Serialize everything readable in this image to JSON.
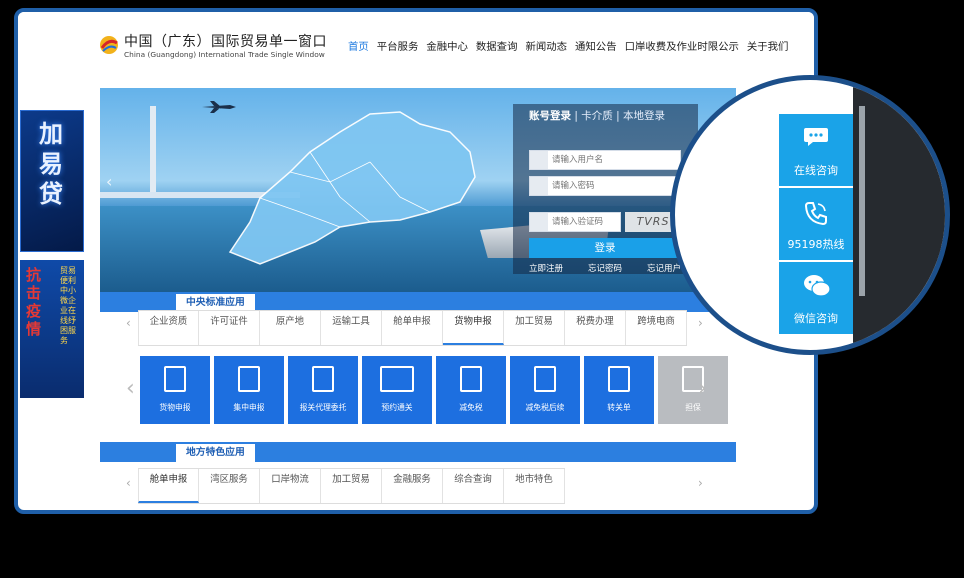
{
  "header": {
    "logo_title": "中国（广东）国际贸易单一窗口",
    "logo_subtitle": "China (Guangdong) International Trade Single Window",
    "nav": [
      "首页",
      "平台服务",
      "金融中心",
      "数据查询",
      "新闻动态",
      "通知公告",
      "口岸收费及作业时限公示",
      "关于我们"
    ],
    "active_nav": "首页"
  },
  "ads": {
    "ad1_text": "加易贷",
    "ad2_title": "抗击疫情",
    "ad2_text": "贸易便利中小微企业在线纾困服务"
  },
  "login": {
    "tab_account": "账号登录",
    "tab_card": "卡介质",
    "tab_local": "本地登录",
    "username_placeholder": "请输入用户名",
    "password_placeholder": "请输入密码",
    "captcha_placeholder": "请输入验证码",
    "captcha_text": "TVRS",
    "login_button": "登录",
    "register": "立即注册",
    "forgot_password": "忘记密码",
    "forgot_username": "忘记用户"
  },
  "central": {
    "label": "中央标准应用",
    "tabs": [
      "企业资质",
      "许可证件",
      "原产地",
      "运输工具",
      "舱单申报",
      "货物申报",
      "加工贸易",
      "税费办理",
      "跨境电商"
    ],
    "active_tab": "货物申报",
    "services": [
      "货物申报",
      "集中申报",
      "报关代理委托",
      "预约通关",
      "减免税",
      "减免税后续",
      "转关单",
      "担保"
    ]
  },
  "local": {
    "label": "地方特色应用",
    "tabs": [
      "舱单申报",
      "湾区服务",
      "口岸物流",
      "加工贸易",
      "金融服务",
      "综合查询",
      "地市特色"
    ],
    "active_tab": "舱单申报"
  },
  "side_service": {
    "items": [
      "在线咨询",
      "95198热线",
      "微信咨询"
    ]
  },
  "colors": {
    "brand_blue": "#2c7fe0",
    "service_blue": "#1aa3e8",
    "frame": "#1f5fa8"
  }
}
